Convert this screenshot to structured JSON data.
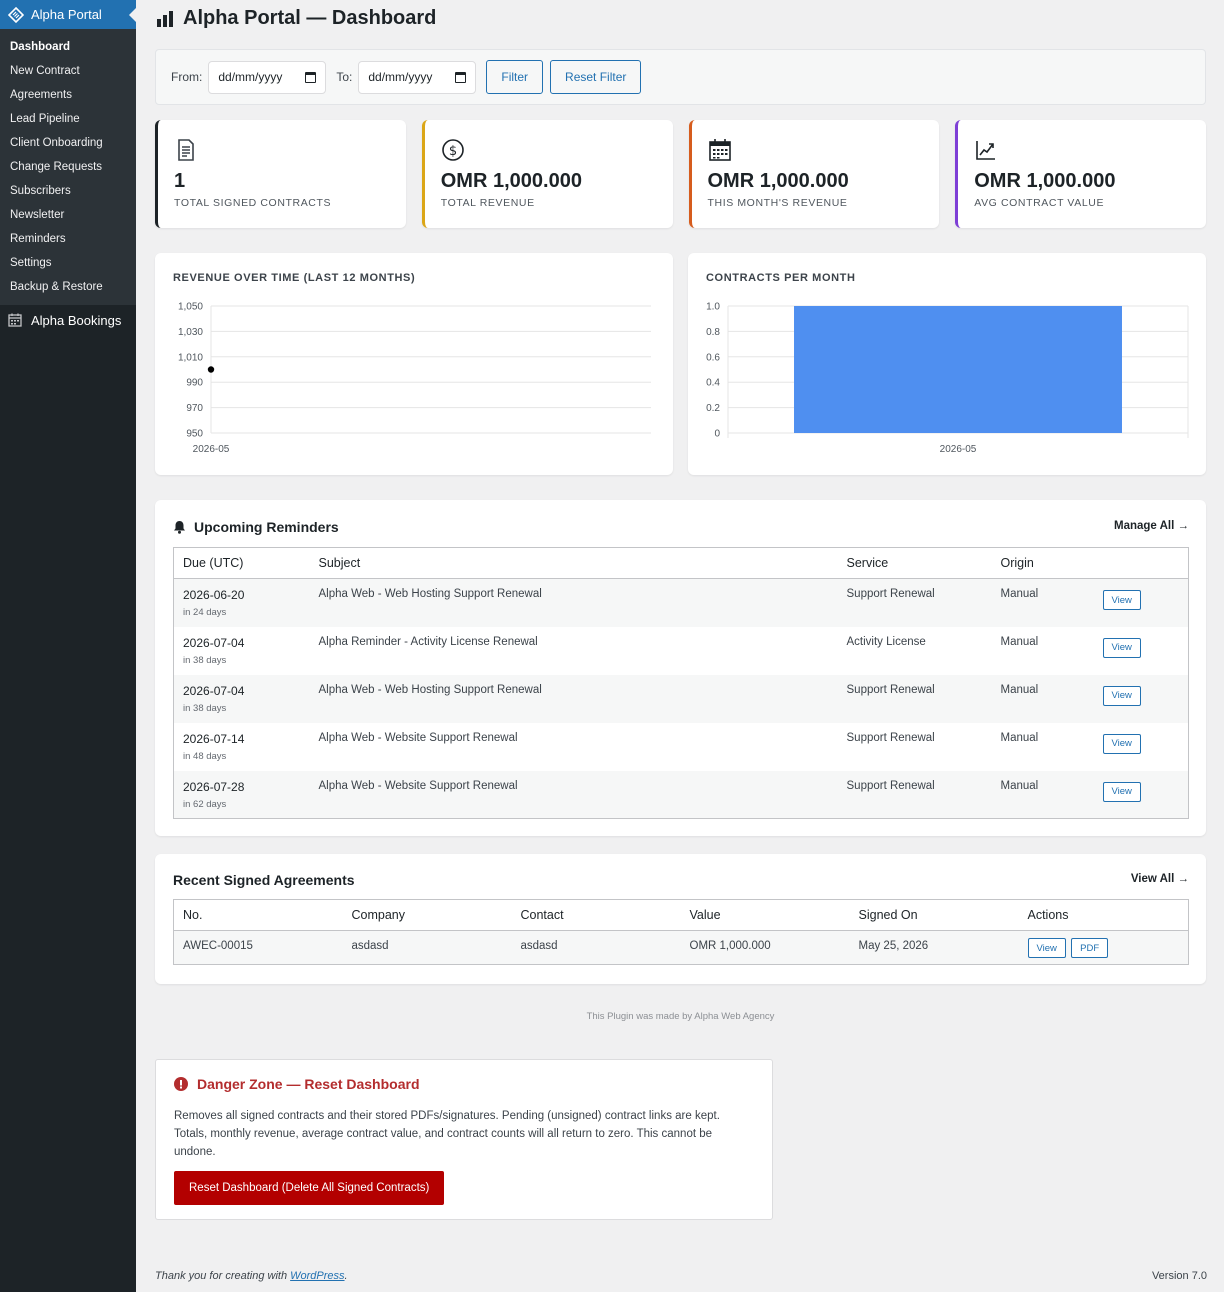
{
  "sidebar": {
    "brand": "Alpha Portal",
    "items": [
      {
        "label": "Dashboard"
      },
      {
        "label": "New Contract"
      },
      {
        "label": "Agreements"
      },
      {
        "label": "Lead Pipeline"
      },
      {
        "label": "Client Onboarding"
      },
      {
        "label": "Change Requests"
      },
      {
        "label": "Subscribers"
      },
      {
        "label": "Newsletter"
      },
      {
        "label": "Reminders"
      },
      {
        "label": "Settings"
      },
      {
        "label": "Backup & Restore"
      }
    ],
    "second_menu": "Alpha Bookings"
  },
  "page": {
    "title": "Alpha Portal — Dashboard"
  },
  "filter": {
    "from_label": "From:",
    "from_value": "dd/mm/yyyy",
    "to_label": "To:",
    "to_value": "dd/mm/yyyy",
    "filter_button": "Filter",
    "reset_button": "Reset Filter"
  },
  "stats": [
    {
      "value": "1",
      "label": "TOTAL SIGNED CONTRACTS",
      "color": "#1d2327",
      "icon": "document-icon"
    },
    {
      "value": "OMR 1,000.000",
      "label": "TOTAL REVENUE",
      "color": "#dba617",
      "icon": "dollar-icon"
    },
    {
      "value": "OMR 1,000.000",
      "label": "THIS MONTH'S REVENUE",
      "color": "#d63638",
      "icon": "calendar-icon"
    },
    {
      "value": "OMR 1,000.000",
      "label": "AVG CONTRACT VALUE",
      "color": "#8c3fb8",
      "icon": "trend-chart-icon"
    }
  ],
  "charts": {
    "revenue_title": "REVENUE OVER TIME (LAST 12 MONTHS)",
    "contracts_title": "CONTRACTS PER MONTH"
  },
  "chart_data": [
    {
      "type": "line",
      "title": "REVENUE OVER TIME (LAST 12 MONTHS)",
      "x": [
        "2026-05"
      ],
      "series": [
        {
          "values": [
            1000
          ]
        }
      ],
      "yticks": [
        "1,050",
        "1,030",
        "1,010",
        "990",
        "970",
        "950"
      ],
      "ylim": [
        950,
        1050
      ],
      "grid": true
    },
    {
      "type": "bar",
      "title": "CONTRACTS PER MONTH",
      "categories": [
        "2026-05"
      ],
      "values": [
        1
      ],
      "yticks": [
        "1.0",
        "0.8",
        "0.6",
        "0.4",
        "0.2",
        "0"
      ],
      "ylim": [
        0,
        1
      ],
      "grid": true,
      "bar_color": "#4f8ff0"
    }
  ],
  "reminders": {
    "title": "Upcoming Reminders",
    "manage_link": "Manage All →",
    "headers": [
      "Due (UTC)",
      "Subject",
      "Service",
      "Origin",
      ""
    ],
    "rows": [
      {
        "due": "2026-06-20",
        "in": "in 24 days",
        "subject": "Alpha Web - Web Hosting Support Renewal",
        "service": "Support Renewal",
        "origin": "Manual",
        "action": "View"
      },
      {
        "due": "2026-07-04",
        "in": "in 38 days",
        "subject": "Alpha Reminder - Activity License Renewal",
        "service": "Activity License",
        "origin": "Manual",
        "action": "View"
      },
      {
        "due": "2026-07-04",
        "in": "in 38 days",
        "subject": "Alpha Web - Web Hosting Support Renewal",
        "service": "Support Renewal",
        "origin": "Manual",
        "action": "View"
      },
      {
        "due": "2026-07-14",
        "in": "in 48 days",
        "subject": "Alpha Web - Website Support Renewal",
        "service": "Support Renewal",
        "origin": "Manual",
        "action": "View"
      },
      {
        "due": "2026-07-28",
        "in": "in 62 days",
        "subject": "Alpha Web - Website Support Renewal",
        "service": "Support Renewal",
        "origin": "Manual",
        "action": "View"
      }
    ]
  },
  "agreements": {
    "title": "Recent Signed Agreements",
    "view_all": "View All →",
    "headers": [
      "No.",
      "Company",
      "Contact",
      "Value",
      "Signed On",
      "Actions"
    ],
    "rows": [
      {
        "no": "AWEC-00015",
        "company": "asdasd",
        "contact": "asdasd",
        "value": "OMR 1,000.000",
        "signed": "May 25, 2026",
        "view": "View",
        "pdf": "PDF"
      }
    ]
  },
  "credit": "This Plugin was made by Alpha Web Agency",
  "danger": {
    "title": "Danger Zone — Reset Dashboard",
    "description": "Removes all signed contracts and their stored PDFs/signatures. Pending (unsigned) contract links are kept. Totals, monthly revenue, average contract value, and contract counts will all return to zero. This cannot be undone.",
    "button": "Reset Dashboard (Delete All Signed Contracts)"
  },
  "footer": {
    "thanks_prefix": "Thank you for creating with ",
    "thanks_link": "WordPress",
    "thanks_suffix": ".",
    "version": "Version 7.0"
  }
}
